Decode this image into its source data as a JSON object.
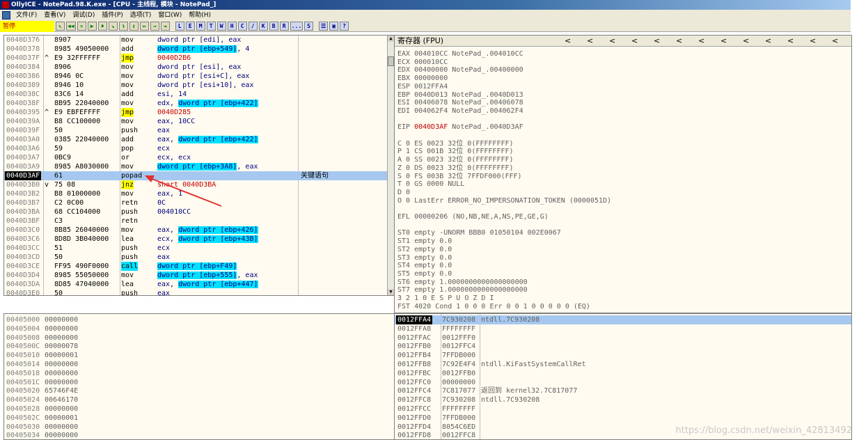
{
  "window": {
    "title": "OllyICE - NotePad.98.K.exe - [CPU - 主线程, 模块 - NotePad_]"
  },
  "menu": [
    "文件(F)",
    "查看(V)",
    "调试(D)",
    "插件(P)",
    "选项(T)",
    "窗口(W)",
    "帮助(H)"
  ],
  "toolbar": {
    "status": "暂停",
    "arrow_buttons": [
      "↖",
      "◀◀",
      "✕",
      "▶",
      "⏸",
      "↘",
      "↴",
      "↧",
      "↦",
      "→",
      "⇥"
    ],
    "letter_buttons": [
      "L",
      "E",
      "M",
      "T",
      "W",
      "H",
      "C",
      "/",
      "K",
      "B",
      "R",
      "...",
      "S"
    ],
    "end_buttons": [
      "☰",
      "▣",
      "?"
    ]
  },
  "disasm": {
    "rows": [
      {
        "addr": "0040D376",
        "mark": "",
        "hex": "8907",
        "mn": "mov",
        "mn_style": "",
        "op": "dword ptr [edi], eax",
        "comment": ""
      },
      {
        "addr": "0040D378",
        "mark": "",
        "hex": "8985 49050000",
        "mn": "add",
        "mn_style": "",
        "op": "dword ptr [ebp+549], 4",
        "comment": ""
      },
      {
        "addr": "0040D37F",
        "mark": "^",
        "hex": "E9 32FFFFFF",
        "mn": "jmp",
        "mn_style": "jmp",
        "op": "0040D2B6",
        "comment": ""
      },
      {
        "addr": "0040D384",
        "mark": "",
        "hex": "8906",
        "mn": "mov",
        "mn_style": "",
        "op": "dword ptr [esi], eax",
        "comment": ""
      },
      {
        "addr": "0040D386",
        "mark": "",
        "hex": "8946 0C",
        "mn": "mov",
        "mn_style": "",
        "op": "dword ptr [esi+C], eax",
        "comment": ""
      },
      {
        "addr": "0040D389",
        "mark": "",
        "hex": "8946 10",
        "mn": "mov",
        "mn_style": "",
        "op": "dword ptr [esi+10], eax",
        "comment": ""
      },
      {
        "addr": "0040D38C",
        "mark": "",
        "hex": "83C6 14",
        "mn": "add",
        "mn_style": "",
        "op": "esi, 14",
        "comment": ""
      },
      {
        "addr": "0040D38F",
        "mark": "",
        "hex": "8B95 22040000",
        "mn": "mov",
        "mn_style": "",
        "op": "edx, dword ptr [ebp+422]",
        "comment": ""
      },
      {
        "addr": "0040D395",
        "mark": "^",
        "hex": "E9 EBFEFFFF",
        "mn": "jmp",
        "mn_style": "jmp",
        "op": "0040D285",
        "comment": ""
      },
      {
        "addr": "0040D39A",
        "mark": "",
        "hex": "B8 CC100000",
        "mn": "mov",
        "mn_style": "",
        "op": "eax, 10CC",
        "comment": ""
      },
      {
        "addr": "0040D39F",
        "mark": "",
        "hex": "50",
        "mn": "push",
        "mn_style": "",
        "op": "eax",
        "comment": ""
      },
      {
        "addr": "0040D3A0",
        "mark": "",
        "hex": "0385 22040000",
        "mn": "add",
        "mn_style": "",
        "op": "eax, dword ptr [ebp+422]",
        "comment": ""
      },
      {
        "addr": "0040D3A6",
        "mark": "",
        "hex": "59",
        "mn": "pop",
        "mn_style": "",
        "op": "ecx",
        "comment": ""
      },
      {
        "addr": "0040D3A7",
        "mark": "",
        "hex": "0BC9",
        "mn": "or",
        "mn_style": "",
        "op": "ecx, ecx",
        "comment": ""
      },
      {
        "addr": "0040D3A9",
        "mark": "",
        "hex": "8985 A8030000",
        "mn": "mov",
        "mn_style": "",
        "op": "dword ptr [ebp+3A8], eax",
        "comment": ""
      },
      {
        "addr": "0040D3AF",
        "mark": "",
        "hex": "61",
        "mn": "popad",
        "mn_style": "",
        "op": "",
        "comment": "关键语句"
      },
      {
        "addr": "0040D3B0",
        "mark": "v",
        "hex": "75 08",
        "mn": "jnz",
        "mn_style": "jmp",
        "op": "short 0040D3BA",
        "comment": ""
      },
      {
        "addr": "0040D3B2",
        "mark": "",
        "hex": "B8 01000000",
        "mn": "mov",
        "mn_style": "",
        "op": "eax, 1",
        "comment": ""
      },
      {
        "addr": "0040D3B7",
        "mark": "",
        "hex": "C2 0C00",
        "mn": "retn",
        "mn_style": "",
        "op": "0C",
        "comment": ""
      },
      {
        "addr": "0040D3BA",
        "mark": "",
        "hex": "68 CC104000",
        "mn": "push",
        "mn_style": "",
        "op": "004010CC",
        "comment": ""
      },
      {
        "addr": "0040D3BF",
        "mark": "",
        "hex": "C3",
        "mn": "retn",
        "mn_style": "",
        "op": "",
        "comment": ""
      },
      {
        "addr": "0040D3C0",
        "mark": "",
        "hex": "8B85 26040000",
        "mn": "mov",
        "mn_style": "",
        "op": "eax, dword ptr [ebp+426]",
        "comment": ""
      },
      {
        "addr": "0040D3C6",
        "mark": "",
        "hex": "8D8D 3B040000",
        "mn": "lea",
        "mn_style": "",
        "op": "ecx, dword ptr [ebp+43B]",
        "comment": ""
      },
      {
        "addr": "0040D3CC",
        "mark": "",
        "hex": "51",
        "mn": "push",
        "mn_style": "",
        "op": "ecx",
        "comment": ""
      },
      {
        "addr": "0040D3CD",
        "mark": "",
        "hex": "50",
        "mn": "push",
        "mn_style": "",
        "op": "eax",
        "comment": ""
      },
      {
        "addr": "0040D3CE",
        "mark": "",
        "hex": "FF95 490F0000",
        "mn": "call",
        "mn_style": "call",
        "op": "dword ptr [ebp+F49]",
        "comment": ""
      },
      {
        "addr": "0040D3D4",
        "mark": "",
        "hex": "8985 55050000",
        "mn": "mov",
        "mn_style": "",
        "op": "dword ptr [ebp+555], eax",
        "comment": ""
      },
      {
        "addr": "0040D3DA",
        "mark": "",
        "hex": "8D85 47040000",
        "mn": "lea",
        "mn_style": "",
        "op": "eax, dword ptr [ebp+447]",
        "comment": ""
      },
      {
        "addr": "0040D3E0",
        "mark": "",
        "hex": "50",
        "mn": "push",
        "mn_style": "",
        "op": "eax",
        "comment": ""
      }
    ],
    "selected_index": 15
  },
  "registers": {
    "header": "寄存器 (FPU)",
    "lines": [
      "EAX 004010CC NotePad_.004010CC",
      "ECX 000010CC",
      "EDX 00400000 NotePad_.00400000",
      "EBX 00000000",
      "ESP 0012FFA4",
      "EBP 0040D013 NotePad_.0040D013",
      "ESI 00406078 NotePad_.00406078",
      "EDI 004062F4 NotePad_.004062F4",
      "",
      "EIP 0040D3AF NotePad_.0040D3AF",
      "",
      "C 0  ES 0023 32位 0(FFFFFFFF)",
      "P 1  CS 001B 32位 0(FFFFFFFF)",
      "A 0  SS 0023 32位 0(FFFFFFFF)",
      "Z 0  DS 0023 32位 0(FFFFFFFF)",
      "S 0  FS 003B 32位 7FFDF000(FFF)",
      "T 0  GS 0000 NULL",
      "D 0",
      "O 0  LastErr ERROR_NO_IMPERSONATION_TOKEN (0000051D)",
      "",
      "EFL 00000206 (NO,NB,NE,A,NS,PE,GE,G)",
      "",
      "ST0 empty -UNORM BBB0 01050104 002E0067",
      "ST1 empty 0.0",
      "ST2 empty 0.0",
      "ST3 empty 0.0",
      "ST4 empty 0.0",
      "ST5 empty 0.0",
      "ST6 empty 1.0000000000000000000",
      "ST7 empty 1.0000000000000000000",
      "               3 2 1 0      E S P U O Z D I",
      "FST 4020  Cond 1 0 0 0  Err 0 0 1 0 0 0 0 0  (EQ)"
    ],
    "eip_value": "0040D3AF"
  },
  "dump": {
    "rows": [
      {
        "addr": "00405000",
        "val": "00000000"
      },
      {
        "addr": "00405004",
        "val": "00000000"
      },
      {
        "addr": "00405008",
        "val": "00000000"
      },
      {
        "addr": "0040500C",
        "val": "00000078"
      },
      {
        "addr": "00405010",
        "val": "00000001"
      },
      {
        "addr": "00405014",
        "val": "00000000"
      },
      {
        "addr": "00405018",
        "val": "00000000"
      },
      {
        "addr": "0040501C",
        "val": "00000000"
      },
      {
        "addr": "00405020",
        "val": "65746F4E"
      },
      {
        "addr": "00405024",
        "val": "00646170"
      },
      {
        "addr": "00405028",
        "val": "00000000"
      },
      {
        "addr": "0040502C",
        "val": "00000001"
      },
      {
        "addr": "00405030",
        "val": "00000000"
      },
      {
        "addr": "00405034",
        "val": "00000000"
      }
    ]
  },
  "stack": {
    "rows": [
      {
        "addr": "0012FFA4",
        "val": "7C930208",
        "com": "ntdll.7C930208"
      },
      {
        "addr": "0012FFA8",
        "val": "FFFFFFFF",
        "com": ""
      },
      {
        "addr": "0012FFAC",
        "val": "0012FFF0",
        "com": ""
      },
      {
        "addr": "0012FFB0",
        "val": "0012FFC4",
        "com": ""
      },
      {
        "addr": "0012FFB4",
        "val": "7FFDB000",
        "com": ""
      },
      {
        "addr": "0012FFB8",
        "val": "7C92E4F4",
        "com": "ntdll.KiFastSystemCallRet"
      },
      {
        "addr": "0012FFBC",
        "val": "0012FFB0",
        "com": ""
      },
      {
        "addr": "0012FFC0",
        "val": "00000000",
        "com": ""
      },
      {
        "addr": "0012FFC4",
        "val": "7C817077",
        "com": "返回到 kernel32.7C817077"
      },
      {
        "addr": "0012FFC8",
        "val": "7C930208",
        "com": "ntdll.7C930208"
      },
      {
        "addr": "0012FFCC",
        "val": "FFFFFFFF",
        "com": ""
      },
      {
        "addr": "0012FFD0",
        "val": "7FFDB000",
        "com": ""
      },
      {
        "addr": "0012FFD4",
        "val": "8054C6ED",
        "com": ""
      },
      {
        "addr": "0012FFD8",
        "val": "0012FFC8",
        "com": ""
      }
    ]
  },
  "watermark": "https://blog.csdn.net/weixin_42813492",
  "colors": {
    "selection": "#a6c8f0",
    "jump_highlight": "#ffff00",
    "call_highlight": "#00e0ff",
    "annotation_arrow": "#e03030"
  }
}
